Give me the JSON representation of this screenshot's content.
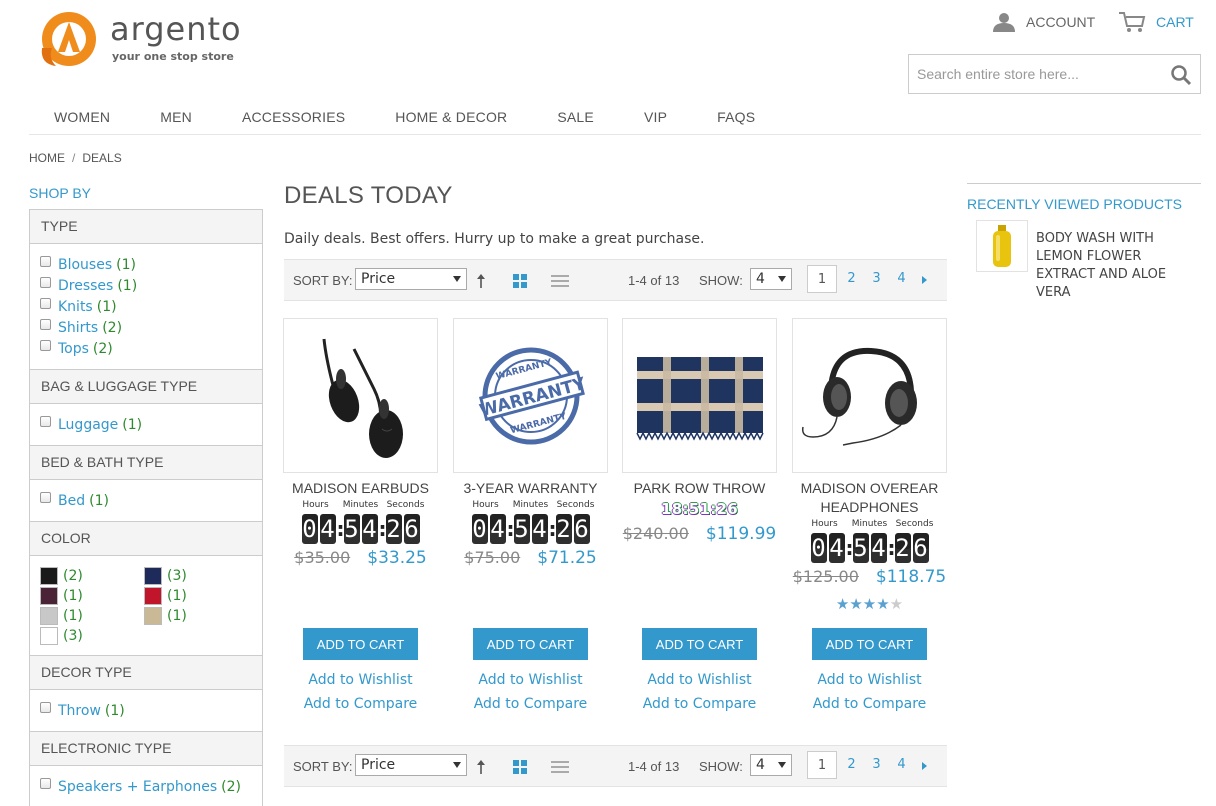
{
  "brand": {
    "name": "argento",
    "tagline": "your one stop store",
    "accent": "#3399cc",
    "logo_color": "#f08c1c"
  },
  "header": {
    "account_label": "ACCOUNT",
    "account_icon": "user-icon",
    "cart_label": "CART",
    "cart_icon": "cart-icon",
    "search_placeholder": "Search entire store here...",
    "search_icon": "search-icon"
  },
  "nav": [
    "WOMEN",
    "MEN",
    "ACCESSORIES",
    "HOME & DECOR",
    "SALE",
    "VIP",
    "FAQS"
  ],
  "breadcrumb": {
    "home": "HOME",
    "sep": "/",
    "current": "DEALS"
  },
  "sidebar": {
    "title": "SHOP BY",
    "type": {
      "title": "TYPE",
      "options": [
        {
          "label": "Blouses",
          "count": "(1)"
        },
        {
          "label": "Dresses",
          "count": "(1)"
        },
        {
          "label": "Knits",
          "count": "(1)"
        },
        {
          "label": "Shirts",
          "count": "(2)"
        },
        {
          "label": "Tops",
          "count": "(2)"
        }
      ]
    },
    "bag": {
      "title": "BAG & LUGGAGE TYPE",
      "options": [
        {
          "label": "Luggage",
          "count": "(1)"
        }
      ]
    },
    "bed": {
      "title": "BED & BATH TYPE",
      "options": [
        {
          "label": "Bed",
          "count": "(1)"
        }
      ]
    },
    "color": {
      "title": "COLOR",
      "swatches": [
        {
          "color": "#1a1a1a",
          "count": "(2)"
        },
        {
          "color": "#1e2a5a",
          "count": "(3)"
        },
        {
          "color": "#4a2436",
          "count": "(1)"
        },
        {
          "color": "#c0152a",
          "count": "(1)"
        },
        {
          "color": "#c8c8c8",
          "count": "(1)"
        },
        {
          "color": "#c9b994",
          "count": "(1)"
        },
        {
          "color": "#ffffff",
          "count": "(3)"
        }
      ]
    },
    "decor": {
      "title": "DECOR TYPE",
      "options": [
        {
          "label": "Throw",
          "count": "(1)"
        }
      ]
    },
    "electronic": {
      "title": "ELECTRONIC TYPE",
      "options": [
        {
          "label": "Speakers + Earphones",
          "count": "(2)"
        }
      ]
    }
  },
  "main": {
    "title": "DEALS TODAY",
    "description": "Daily deals. Best offers. Hurry up to make a great purchase."
  },
  "toolbar": {
    "sort_label": "SORT BY:",
    "sort_value": "Price",
    "count": "1-4 of 13",
    "show_label": "SHOW:",
    "show_value": "4",
    "pages": [
      "1",
      "2",
      "3",
      "4"
    ],
    "current_page": "1"
  },
  "countdown_labels": {
    "hours": "Hours",
    "minutes": "Minutes",
    "seconds": "Seconds"
  },
  "products": [
    {
      "name": "MADISON EARBUDS",
      "timer": [
        "0",
        "4",
        "5",
        "4",
        "2",
        "6"
      ],
      "old_price": "$35.00",
      "price": "$33.25",
      "cart": "ADD TO CART",
      "wishlist": "Add to Wishlist",
      "compare": "Add to Compare"
    },
    {
      "name": "3-YEAR WARRANTY",
      "timer": [
        "0",
        "4",
        "5",
        "4",
        "2",
        "6"
      ],
      "old_price": "$75.00",
      "price": "$71.25",
      "cart": "ADD TO CART",
      "wishlist": "Add to Wishlist",
      "compare": "Add to Compare"
    },
    {
      "name": "PARK ROW THROW",
      "small_timer": "18:51:26",
      "old_price": "$240.00",
      "price": "$119.99",
      "cart": "ADD TO CART",
      "wishlist": "Add to Wishlist",
      "compare": "Add to Compare"
    },
    {
      "name": "MADISON OVEREAR HEADPHONES",
      "timer": [
        "0",
        "4",
        "5",
        "4",
        "2",
        "6"
      ],
      "old_price": "$125.00",
      "price": "$118.75",
      "rating": 4,
      "cart": "ADD TO CART",
      "wishlist": "Add to Wishlist",
      "compare": "Add to Compare"
    }
  ],
  "warranty_stamp": {
    "arc_top": "WARRANTY",
    "band": "WARRANTY",
    "arc_bottom": "WARRANTY"
  },
  "recently_viewed": {
    "title": "RECENTLY VIEWED PRODUCTS",
    "items": [
      {
        "name": "BODY WASH WITH LEMON FLOWER EXTRACT AND ALOE VERA"
      }
    ]
  }
}
